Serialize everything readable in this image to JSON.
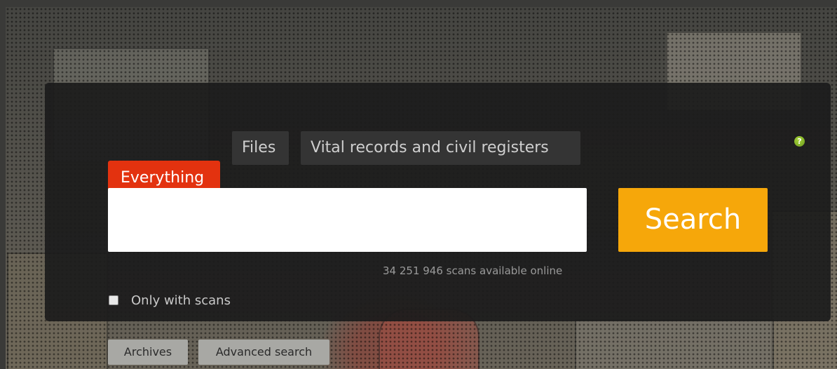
{
  "search_panel": {
    "tabs": [
      {
        "label": "Files"
      },
      {
        "label": "Vital records and civil registers"
      }
    ],
    "active_tab": "Everything",
    "search_input": {
      "value": "",
      "placeholder": ""
    },
    "search_button_label": "Search",
    "scan_count_text": "34 251 946 scans available online",
    "only_with_scans": {
      "label": "Only with scans",
      "checked": false
    },
    "help_icon": "help-icon"
  },
  "bottom_links": {
    "archives_label": "Archives",
    "advanced_search_label": "Advanced search"
  },
  "colors": {
    "panel_background": "#1c1c1c",
    "active_tab": "#e3320f",
    "search_button": "#f6a70a",
    "help_icon": "#8dc22a",
    "link_button": "#a8a8a4"
  }
}
